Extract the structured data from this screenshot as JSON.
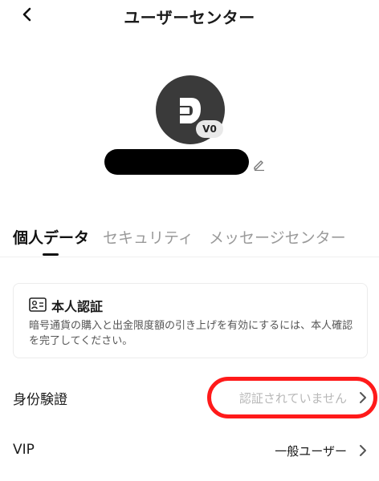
{
  "header": {
    "title": "ユーザーセンター",
    "back_icon": "chevron-left-icon"
  },
  "profile": {
    "level_badge": "V0",
    "avatar_icon": "brand-logo-icon",
    "edit_icon": "pencil-icon"
  },
  "tabs": [
    {
      "label": "個人データ",
      "active": true
    },
    {
      "label": "セキュリティ",
      "active": false
    },
    {
      "label": "メッセージセンター",
      "active": false
    }
  ],
  "kyc_card": {
    "icon": "id-card-icon",
    "title": "本人認証",
    "description": "暗号通貨の購入と出金限度額の引き上げを有効にするには、本人確認を完了してください。"
  },
  "rows": [
    {
      "label": "身份験證",
      "value": "認証されていません",
      "value_color": "#b8b8b8"
    },
    {
      "label": "VIP",
      "value": "一般ユーザー",
      "value_color": "#1b1b1b"
    }
  ],
  "colors": {
    "highlight": "#ff1a1a",
    "avatar_bg": "#3a3a3a"
  }
}
